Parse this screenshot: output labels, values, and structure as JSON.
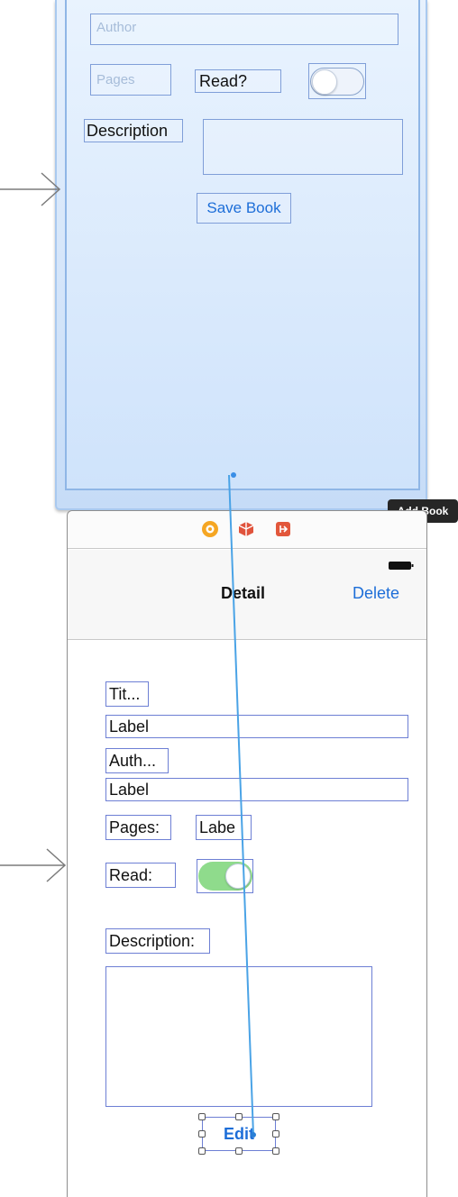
{
  "add_book_scene": {
    "scene_label": "Add Book",
    "author_placeholder": "Author",
    "pages_placeholder": "Pages",
    "read_label": "Read?",
    "read_switch_on": false,
    "description_label": "Description",
    "save_button_label": "Save Book"
  },
  "detail_scene": {
    "nav_title": "Detail",
    "delete_button_label": "Delete",
    "title_caption": "Tit...",
    "title_value": "Label",
    "author_caption": "Auth...",
    "author_value": "Label",
    "pages_caption": "Pages:",
    "pages_value": "Labe",
    "read_caption": "Read:",
    "read_switch_on": true,
    "description_caption": "Description:",
    "edit_button_label": "Edit"
  },
  "dock_icons": [
    "view-controller-icon",
    "first-responder-icon",
    "exit-icon"
  ],
  "colors": {
    "accent": "#1d6ed8",
    "switch_on": "#8fdb8c",
    "selection": "#4aa3e6",
    "scene_tag_bg": "#262626"
  }
}
